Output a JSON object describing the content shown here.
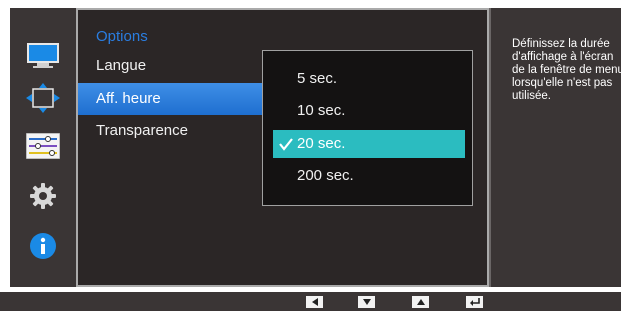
{
  "menu": {
    "title": "Options",
    "items": [
      {
        "label": "Langue"
      },
      {
        "label": "Aff. heure"
      },
      {
        "label": "Transparence"
      }
    ],
    "selected_index": 1
  },
  "dropdown": {
    "options": [
      {
        "label": "5 sec."
      },
      {
        "label": "10 sec."
      },
      {
        "label": "20 sec."
      },
      {
        "label": "200 sec."
      }
    ],
    "selected_index": 2
  },
  "help": {
    "text": "Définissez la durée d'affichage à l'écran de la fenêtre de menu lorsqu'elle n'est pas utilisée."
  },
  "sidebar_icons": [
    {
      "name": "picture-icon"
    },
    {
      "name": "screen-position-icon"
    },
    {
      "name": "picture-settings-icon"
    },
    {
      "name": "system-gear-icon"
    },
    {
      "name": "information-icon"
    }
  ],
  "nav_buttons": [
    {
      "name": "left-arrow-icon"
    },
    {
      "name": "down-arrow-icon"
    },
    {
      "name": "up-arrow-icon"
    },
    {
      "name": "enter-icon"
    }
  ],
  "colors": {
    "accent_blue": "#2a7de0",
    "selected_teal": "#2bbcc0",
    "panel_bg": "#2b2626"
  }
}
